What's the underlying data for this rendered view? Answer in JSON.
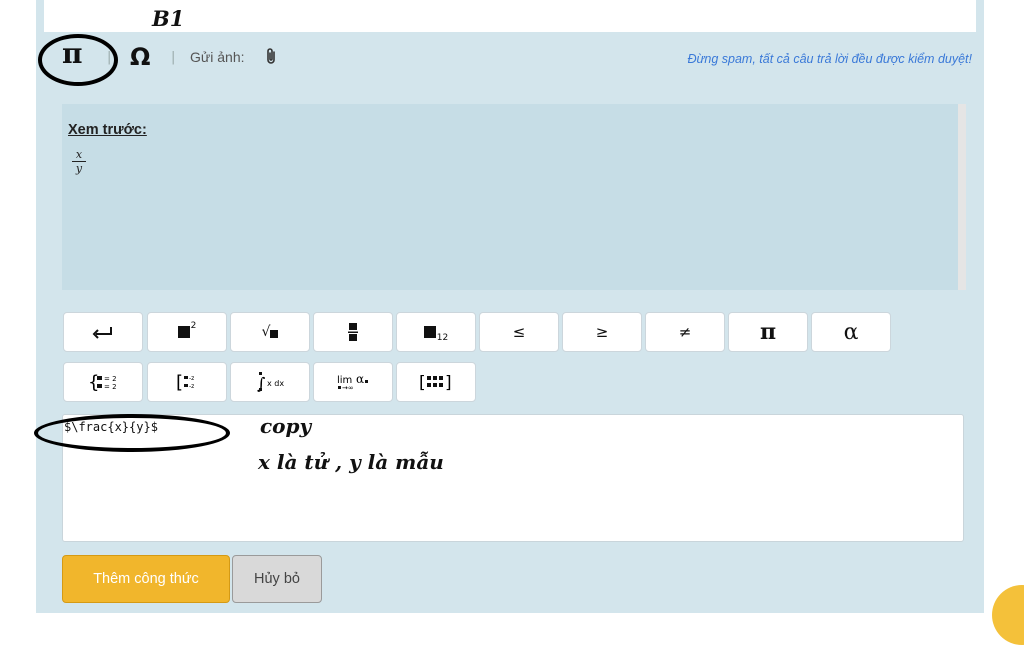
{
  "step_label": "B1",
  "toolbar": {
    "pi_symbol": "π",
    "separator": "|",
    "omega_symbol": "Ω",
    "send_image_label": "Gửi ảnh:",
    "attach_icon": "paperclip-icon",
    "warning": "Đừng spam, tất cả câu trả lời đều được kiểm duyệt!"
  },
  "preview": {
    "label": "Xem trước:",
    "fraction": {
      "numerator": "x",
      "denominator": "y"
    }
  },
  "keys_row1": [
    "↵",
    "x²",
    "√",
    "a/b",
    "x₁₂",
    "≤",
    "≥",
    "≠",
    "π",
    "α"
  ],
  "keys_row1_text": {
    "leq": "≤",
    "geq": "≥",
    "neq": "≠",
    "pi": "π",
    "alpha": "α"
  },
  "keys_row2": [
    "system",
    "matrix-exp",
    "integral",
    "limit",
    "matrix"
  ],
  "input": {
    "value": "$\\frac{x}{y}$"
  },
  "annotations": {
    "copy": "copy",
    "explanation": "x là tử , y là mẫu"
  },
  "buttons": {
    "add_formula": "Thêm công thức",
    "cancel": "Hủy bỏ"
  },
  "colors": {
    "panel": "#d3e5ec",
    "preview_bg": "#c6dde6",
    "accent": "#f1b62c",
    "link": "#3a79d8"
  }
}
